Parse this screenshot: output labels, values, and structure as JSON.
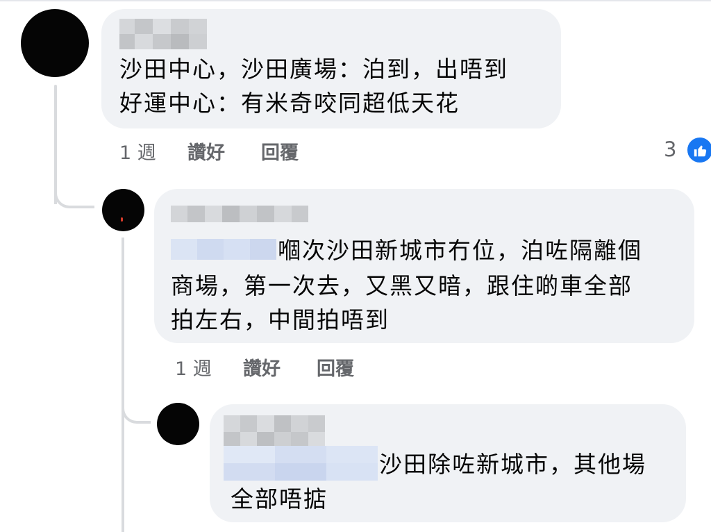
{
  "comments": [
    {
      "text_lines": [
        "沙田中心，沙田廣場：泊到，出唔到",
        "好運中心：有米奇咬同超低天花"
      ],
      "time": "1 週",
      "like_label": "讚好",
      "reply_label": "回覆",
      "reaction_count": "3",
      "reaction_icon": "like-icon",
      "reaction_color": "#1877f2"
    },
    {
      "text_lines": [
        "嗰次沙田新城市冇位，泊咗隔離個",
        "商場，第一次去，又黑又暗，跟住啲車全部",
        "拍左右，中間拍唔到"
      ],
      "time": "1 週",
      "like_label": "讚好",
      "reply_label": "回覆"
    },
    {
      "text_lines": [
        "沙田除咗新城市，其他場",
        "全部唔掂"
      ]
    }
  ]
}
